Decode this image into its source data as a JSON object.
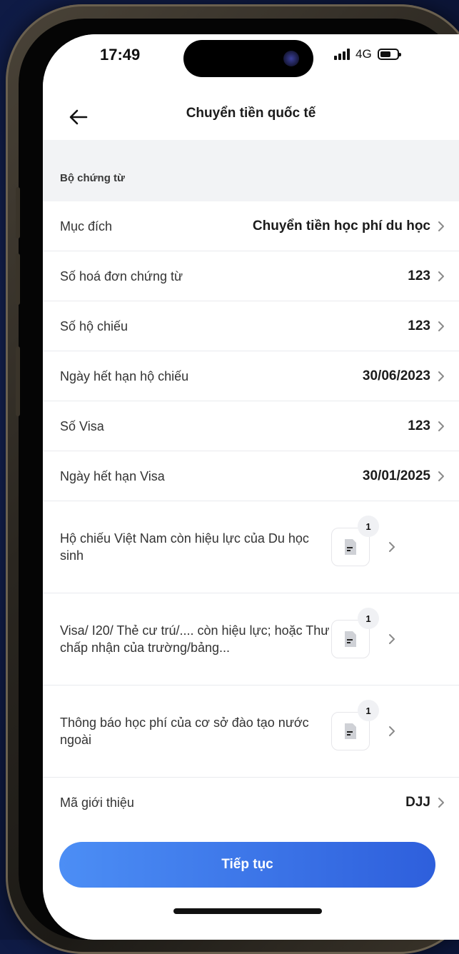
{
  "status_bar": {
    "time": "17:49",
    "network": "4G",
    "signal_icon": "signal-bars-icon",
    "battery_icon": "battery-icon"
  },
  "header": {
    "back_icon": "arrow-left-icon",
    "title": "Chuyển tiền quốc tế"
  },
  "section": {
    "label": "Bộ chứng từ"
  },
  "rows": [
    {
      "label": "Mục đích",
      "value": "Chuyển tiền học phí du học"
    },
    {
      "label": "Số hoá đơn chứng từ",
      "value": "123"
    },
    {
      "label": "Số hộ chiếu",
      "value": "123"
    },
    {
      "label": "Ngày hết hạn hộ chiếu",
      "value": "30/06/2023"
    },
    {
      "label": "Số Visa",
      "value": "123"
    },
    {
      "label": "Ngày hết hạn Visa",
      "value": "30/01/2025"
    },
    {
      "label": "Hộ chiếu Việt Nam còn hiệu lực của Du học sinh",
      "doc_count": "1"
    },
    {
      "label": "Visa/ I20/ Thẻ cư trú/.... còn hiệu lực; hoặc Thư chấp nhận của trường/bảng...",
      "doc_count": "1"
    },
    {
      "label": "Thông báo học phí của cơ sở đào tạo nước ngoài",
      "doc_count": "1"
    },
    {
      "label": "Mã giới thiệu",
      "value": "DJJ"
    }
  ],
  "footer": {
    "continue_label": "Tiếp tục"
  },
  "colors": {
    "primary_start": "#4c8ef5",
    "primary_end": "#2e5fdc",
    "background": "#f2f3f5",
    "backdrop": "#0f1b45"
  }
}
